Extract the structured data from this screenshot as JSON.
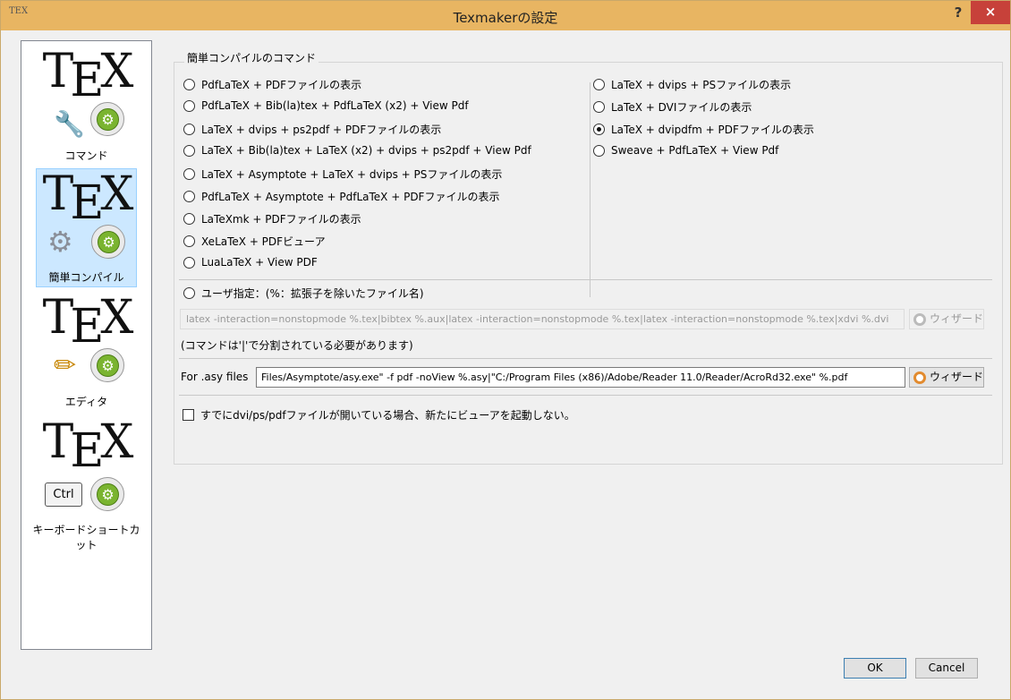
{
  "window": {
    "title": "Texmakerの設定",
    "help": "?",
    "close": "×",
    "app_icon": "TEX"
  },
  "sidebar": {
    "items": [
      {
        "label": "コマンド",
        "selected": false
      },
      {
        "label": "簡単コンパイル",
        "selected": true
      },
      {
        "label": "エディタ",
        "selected": false
      },
      {
        "label": "キーボードショートカット",
        "selected": false
      }
    ],
    "logo_t": "T",
    "logo_e": "E",
    "logo_x": "X",
    "ctrl_key": "Ctrl"
  },
  "quick_build": {
    "group_title": "簡単コンパイルのコマンド",
    "left_options": [
      "PdfLaTeX + PDFファイルの表示",
      "PdfLaTeX + Bib(la)tex + PdfLaTeX (x2) + View Pdf",
      "LaTeX + dvips + ps2pdf + PDFファイルの表示",
      "LaTeX + Bib(la)tex + LaTeX (x2) + dvips + ps2pdf + View Pdf",
      "LaTeX + Asymptote + LaTeX + dvips + PSファイルの表示",
      "PdfLaTeX + Asymptote + PdfLaTeX + PDFファイルの表示",
      "LaTeXmk + PDFファイルの表示",
      "XeLaTeX + PDFビューア",
      "LuaLaTeX + View PDF"
    ],
    "right_options": [
      "LaTeX + dvips + PSファイルの表示",
      "LaTeX + DVIファイルの表示",
      "LaTeX + dvipdfm + PDFファイルの表示",
      "Sweave + PdfLaTeX + View Pdf"
    ],
    "selected_option": "LaTeX + dvipdfm + PDFファイルの表示",
    "user_option": "ユーザ指定：(%：拡張子を除いたファイル名)",
    "user_command": "latex -interaction=nonstopmode %.tex|bibtex %.aux|latex -interaction=nonstopmode %.tex|latex -interaction=nonstopmode %.tex|xdvi %.dvi",
    "wizard_label": "ウィザード",
    "note": "(コマンドは'|'で分割されている必要があります)",
    "asy_label": "For .asy files",
    "asy_command": "Files/Asymptote/asy.exe\" -f pdf -noView %.asy|\"C:/Program Files (x86)/Adobe/Reader 11.0/Reader/AcroRd32.exe\" %.pdf",
    "checkbox_label": "すでにdvi/ps/pdfファイルが開いている場合、新たにビューアを起動しない。",
    "checkbox_checked": false
  },
  "buttons": {
    "ok": "OK",
    "cancel": "Cancel"
  },
  "colors": {
    "titlebar": "#e8b562",
    "close": "#c7413a",
    "selection": "#cce8ff",
    "gear": "#7ab430"
  }
}
